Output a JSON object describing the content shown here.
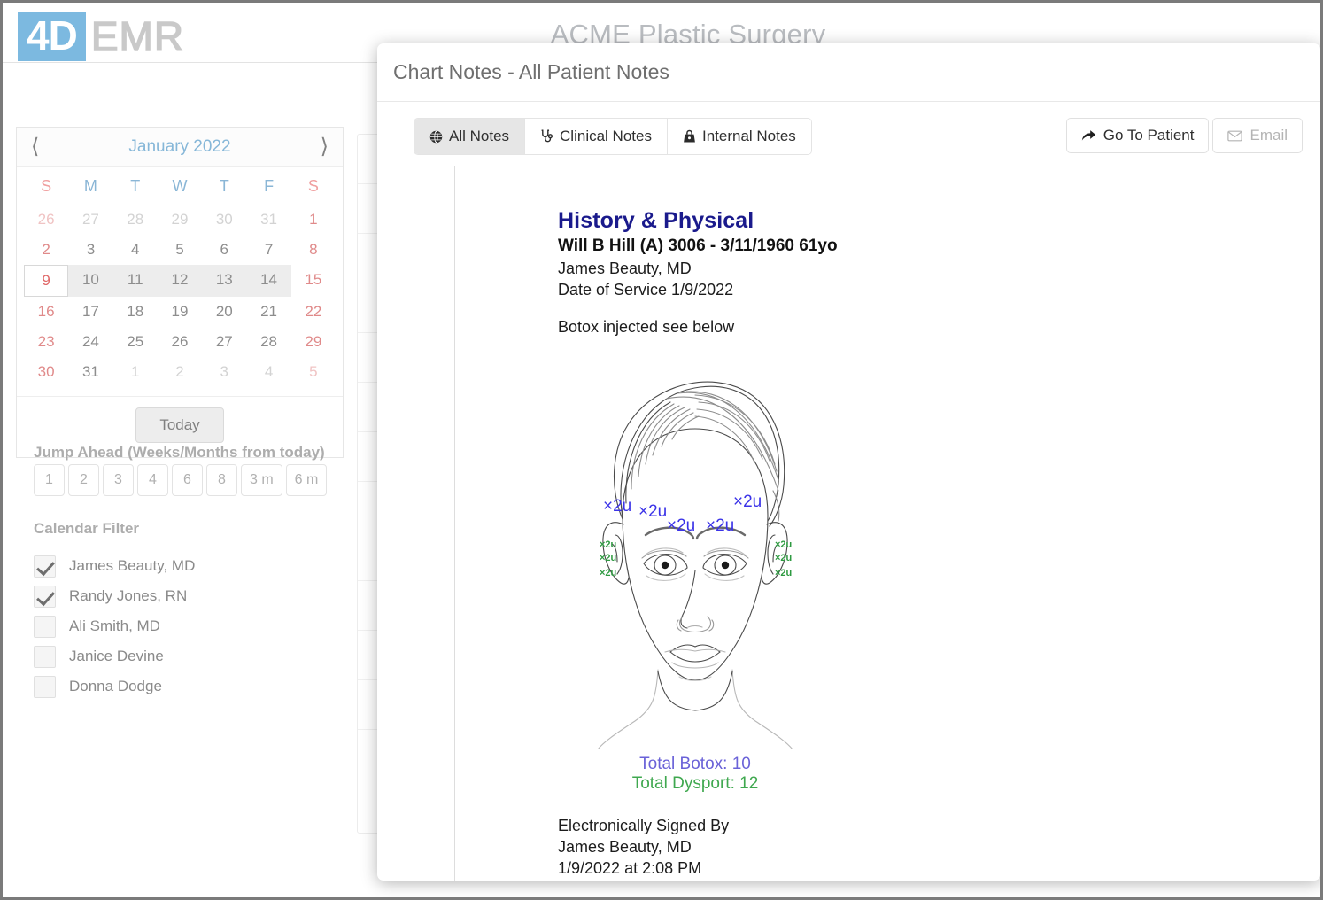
{
  "app": {
    "logo_primary": "4D",
    "logo_secondary": "EMR",
    "practice_name": "ACME Plastic Surgery",
    "brand_color": "#7cb9e0"
  },
  "calendar": {
    "prev_icon": "chevron-left-icon",
    "next_icon": "chevron-right-icon",
    "title": "January 2022",
    "day_headers": [
      "S",
      "M",
      "T",
      "W",
      "T",
      "F",
      "S"
    ],
    "weeks": [
      [
        {
          "d": "26",
          "muted": true,
          "weekend": true
        },
        {
          "d": "27",
          "muted": true,
          "weekend": false
        },
        {
          "d": "28",
          "muted": true,
          "weekend": false
        },
        {
          "d": "29",
          "muted": true,
          "weekend": false
        },
        {
          "d": "30",
          "muted": true,
          "weekend": false
        },
        {
          "d": "31",
          "muted": true,
          "weekend": false
        },
        {
          "d": "1",
          "muted": false,
          "weekend": true
        }
      ],
      [
        {
          "d": "2",
          "muted": false,
          "weekend": true
        },
        {
          "d": "3",
          "muted": false,
          "weekend": false
        },
        {
          "d": "4",
          "muted": false,
          "weekend": false
        },
        {
          "d": "5",
          "muted": false,
          "weekend": false
        },
        {
          "d": "6",
          "muted": false,
          "weekend": false
        },
        {
          "d": "7",
          "muted": false,
          "weekend": false
        },
        {
          "d": "8",
          "muted": false,
          "weekend": true
        }
      ],
      [
        {
          "d": "9",
          "muted": false,
          "weekend": true,
          "selected": true
        },
        {
          "d": "10",
          "muted": false,
          "weekend": false,
          "inweek": true
        },
        {
          "d": "11",
          "muted": false,
          "weekend": false,
          "inweek": true
        },
        {
          "d": "12",
          "muted": false,
          "weekend": false,
          "inweek": true
        },
        {
          "d": "13",
          "muted": false,
          "weekend": false,
          "inweek": true
        },
        {
          "d": "14",
          "muted": false,
          "weekend": false,
          "inweek": true
        },
        {
          "d": "15",
          "muted": false,
          "weekend": true
        }
      ],
      [
        {
          "d": "16",
          "muted": false,
          "weekend": true
        },
        {
          "d": "17",
          "muted": false,
          "weekend": false
        },
        {
          "d": "18",
          "muted": false,
          "weekend": false
        },
        {
          "d": "19",
          "muted": false,
          "weekend": false
        },
        {
          "d": "20",
          "muted": false,
          "weekend": false
        },
        {
          "d": "21",
          "muted": false,
          "weekend": false
        },
        {
          "d": "22",
          "muted": false,
          "weekend": true
        }
      ],
      [
        {
          "d": "23",
          "muted": false,
          "weekend": true
        },
        {
          "d": "24",
          "muted": false,
          "weekend": false
        },
        {
          "d": "25",
          "muted": false,
          "weekend": false
        },
        {
          "d": "26",
          "muted": false,
          "weekend": false
        },
        {
          "d": "27",
          "muted": false,
          "weekend": false
        },
        {
          "d": "28",
          "muted": false,
          "weekend": false
        },
        {
          "d": "29",
          "muted": false,
          "weekend": true
        }
      ],
      [
        {
          "d": "30",
          "muted": false,
          "weekend": true
        },
        {
          "d": "31",
          "muted": false,
          "weekend": false
        },
        {
          "d": "1",
          "muted": true,
          "weekend": false
        },
        {
          "d": "2",
          "muted": true,
          "weekend": false
        },
        {
          "d": "3",
          "muted": true,
          "weekend": false
        },
        {
          "d": "4",
          "muted": true,
          "weekend": false
        },
        {
          "d": "5",
          "muted": true,
          "weekend": true
        }
      ]
    ],
    "today_label": "Today"
  },
  "jump_ahead": {
    "label": "Jump Ahead (Weeks/Months from today)",
    "buttons": [
      "1",
      "2",
      "3",
      "4",
      "6",
      "8",
      "3 m",
      "6 m"
    ]
  },
  "calendar_filter": {
    "label": "Calendar Filter",
    "items": [
      {
        "name": "James Beauty, MD",
        "checked": true
      },
      {
        "name": "Randy Jones, RN",
        "checked": true
      },
      {
        "name": "Ali Smith, MD",
        "checked": false
      },
      {
        "name": "Janice Devine",
        "checked": false
      },
      {
        "name": "Donna Dodge",
        "checked": false
      }
    ]
  },
  "modal": {
    "title": "Chart Notes - All Patient Notes",
    "tabs": [
      {
        "label": "All Notes",
        "icon": "globe-icon",
        "active": true
      },
      {
        "label": "Clinical Notes",
        "icon": "stethoscope-icon",
        "active": false
      },
      {
        "label": "Internal Notes",
        "icon": "lock-safe-icon",
        "active": false
      }
    ],
    "actions": [
      {
        "label": "Go To Patient",
        "icon": "share-arrow-icon",
        "disabled": false
      },
      {
        "label": "Email",
        "icon": "envelope-icon",
        "disabled": true
      }
    ]
  },
  "note": {
    "heading": "History & Physical",
    "heading_color": "#1a1a8c",
    "patient_line": "Will B Hill (A) 3006  -  3/11/1960  61yo",
    "provider": "James Beauty, MD",
    "date_of_service": "Date of Service 1/9/2022",
    "intro": "Botox injected see below",
    "diagram": {
      "blue_markers": [
        "×2u",
        "×2u",
        "×2u",
        "×2u",
        "×2u"
      ],
      "green_markers": [
        "×2u",
        "×2u",
        "×2u",
        "×2u",
        "×2u",
        "×2u"
      ],
      "blue_color": "#3b33e8",
      "green_color": "#2e9a41"
    },
    "total_botox": "Total Botox: 10",
    "total_dysport": "Total Dysport: 12",
    "total_botox_color": "#6a62d8",
    "total_dysport_color": "#3fa84f",
    "signature_label": "Electronically Signed By",
    "signature_name": "James Beauty, MD",
    "signature_timestamp": "1/9/2022 at 2:08 PM"
  }
}
